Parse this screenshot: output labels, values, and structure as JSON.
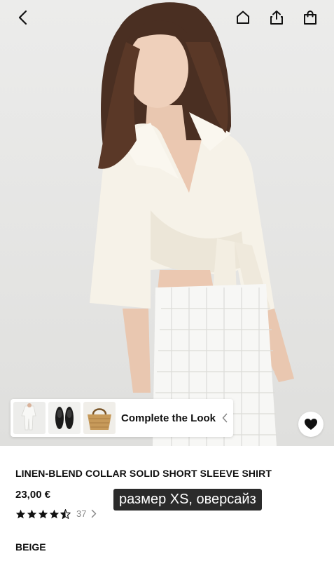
{
  "header": {
    "back_icon": "chevron-left-icon",
    "home_icon": "home-icon",
    "share_icon": "share-icon",
    "bag_icon": "shopping-bag-icon"
  },
  "hero": {
    "image": "model wearing beige linen-blend collar shirt tied at the waist with white crochet skirt",
    "background_color": "#e7e7e6"
  },
  "complete_the_look": {
    "label": "Complete the Look",
    "thumbnails": [
      "white-outfit-thumbnail",
      "black-flats-thumbnail",
      "straw-bag-thumbnail"
    ]
  },
  "product": {
    "title": "LINEN-BLEND COLLAR SOLID SHORT SLEEVE SHIRT",
    "price": "23,00 €",
    "rating_stars": 4.5,
    "rating_count": "37",
    "color": "BEIGE"
  },
  "overlay": {
    "text": "размер XS, оверсайз"
  },
  "favorite_icon": "heart-icon"
}
